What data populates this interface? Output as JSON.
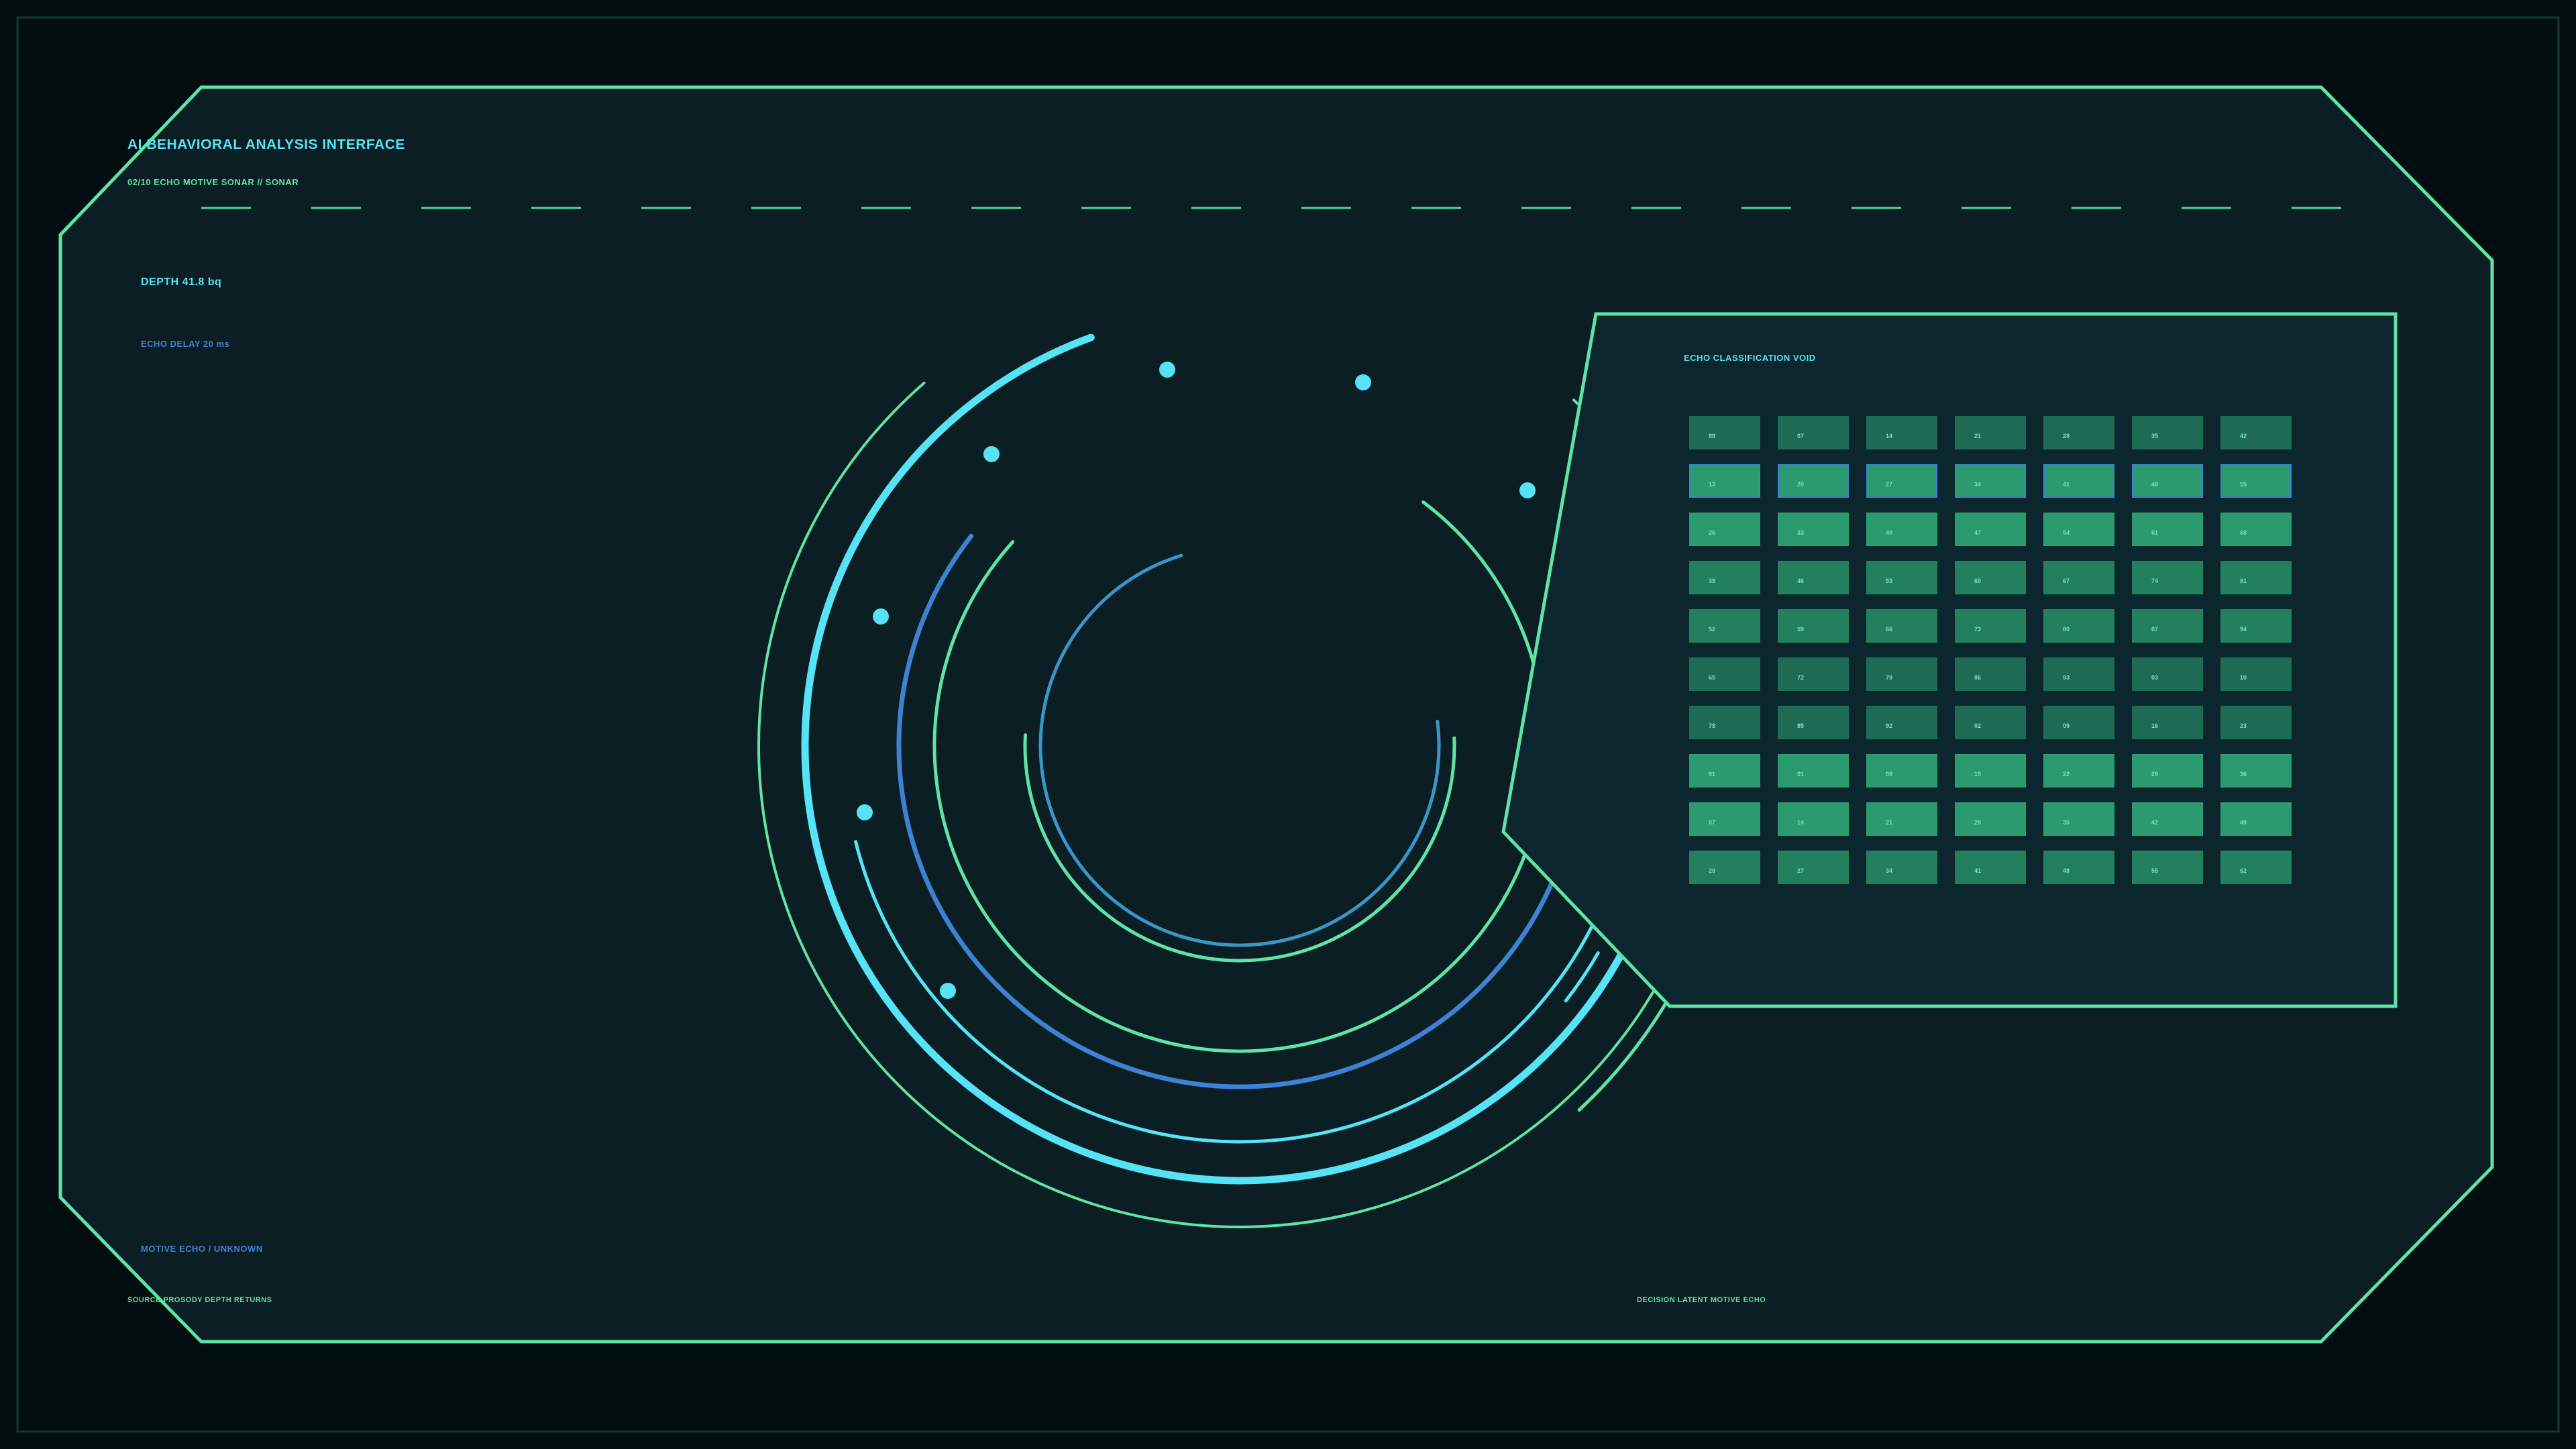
{
  "header": {
    "title": "AI BEHAVIORAL ANALYSIS INTERFACE",
    "subtitle": "02/10  ECHO MOTIVE SONAR  // SONAR"
  },
  "readouts": {
    "depth": "DEPTH 41.8 bq",
    "echo_delay": "ECHO DELAY 20 ms"
  },
  "footer": {
    "motive": "MOTIVE ECHO / UNKNOWN",
    "source": "SOURCE PROSODY DEPTH RETURNS",
    "decision": "DECISION  LATENT MOTIVE ECHO"
  },
  "panel": {
    "title": "ECHO CLASSIFICATION VOID",
    "selected_row": 1,
    "rows": [
      [
        "88",
        "07",
        "14",
        "21",
        "28",
        "35",
        "42"
      ],
      [
        "13",
        "20",
        "27",
        "34",
        "41",
        "48",
        "55"
      ],
      [
        "26",
        "33",
        "40",
        "47",
        "54",
        "61",
        "68"
      ],
      [
        "39",
        "46",
        "53",
        "60",
        "67",
        "74",
        "81"
      ],
      [
        "52",
        "59",
        "66",
        "73",
        "80",
        "87",
        "94"
      ],
      [
        "65",
        "72",
        "79",
        "86",
        "93",
        "03",
        "10"
      ],
      [
        "78",
        "85",
        "92",
        "02",
        "09",
        "16",
        "23"
      ],
      [
        "91",
        "01",
        "08",
        "15",
        "22",
        "29",
        "36"
      ],
      [
        "07",
        "14",
        "21",
        "28",
        "35",
        "42",
        "49"
      ],
      [
        "20",
        "27",
        "34",
        "41",
        "48",
        "55",
        "62"
      ]
    ]
  },
  "colors": {
    "frame": "#5fe3a6",
    "cyan": "#56e3f5",
    "blue": "#3d82d3",
    "steel": "#3a95c8",
    "panel_fill": "#092026",
    "background": "#010d0e"
  }
}
